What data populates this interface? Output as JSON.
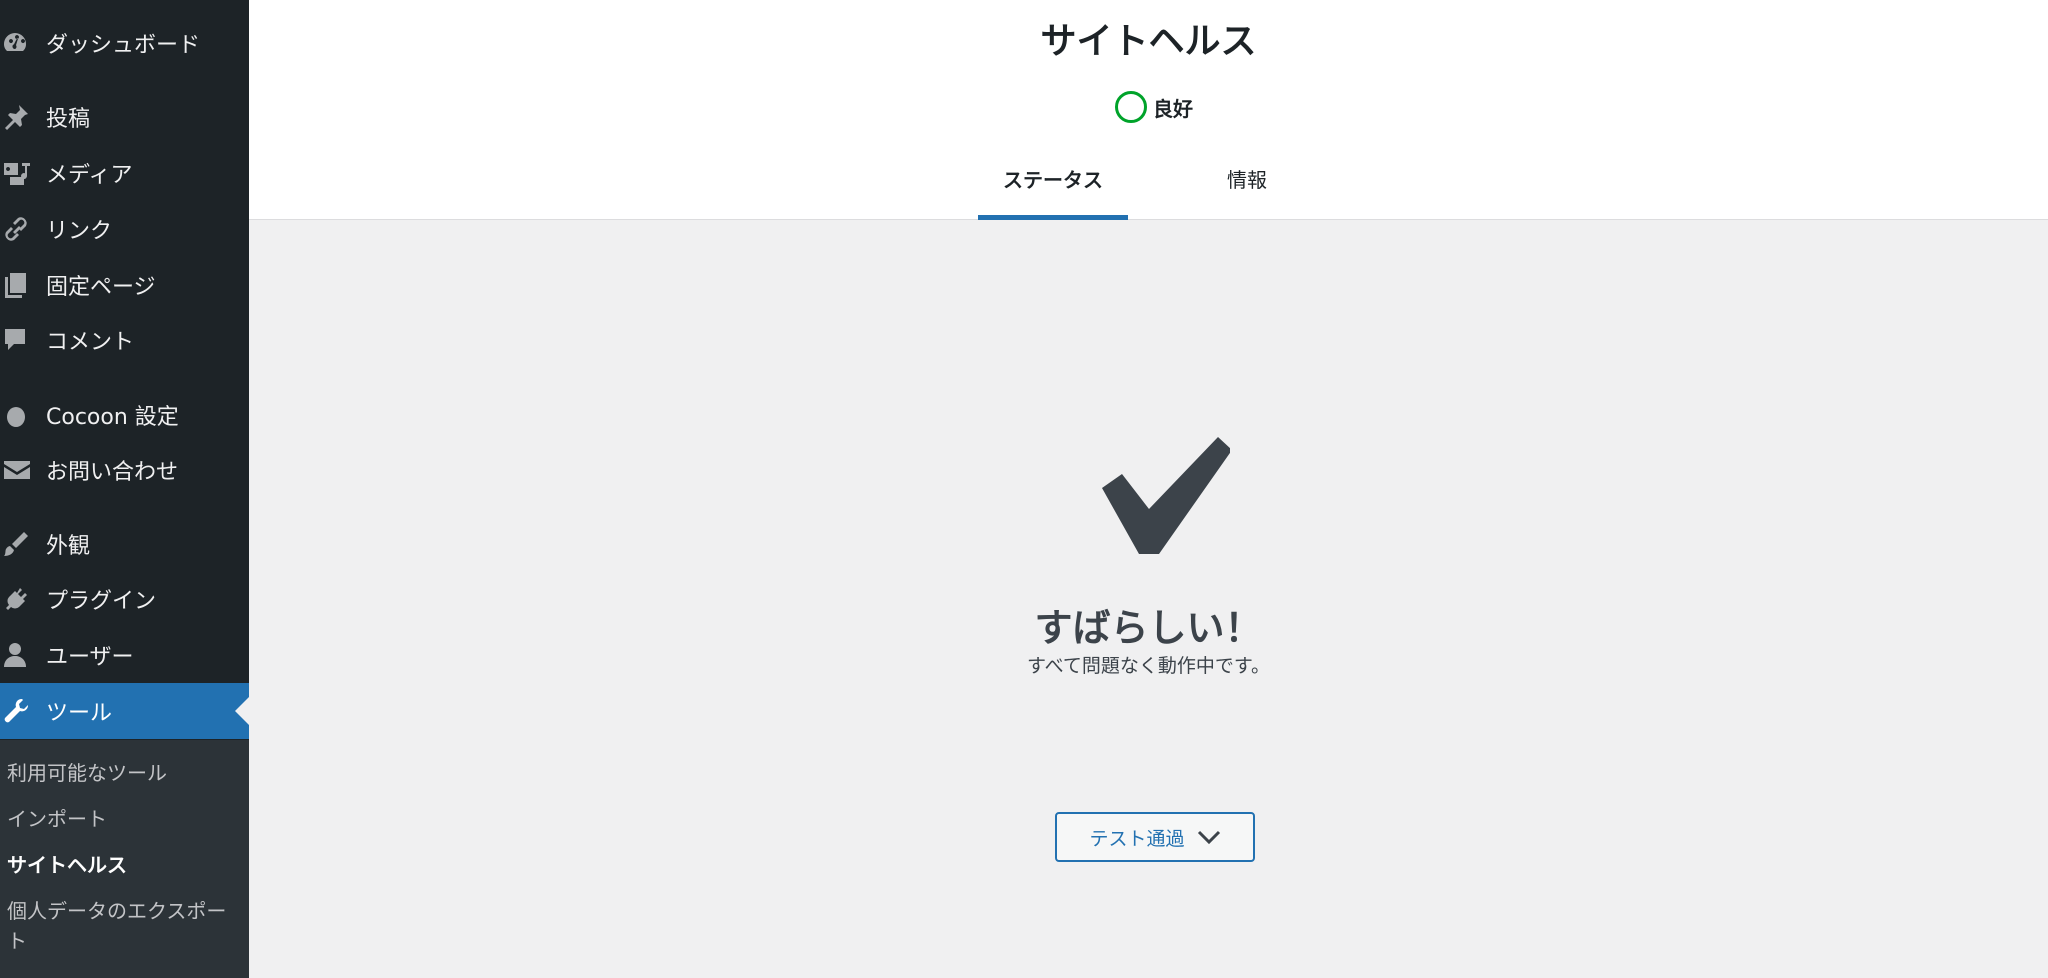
{
  "sidebar": {
    "items": [
      {
        "label": "ダッシュボード",
        "icon": "dashboard-icon"
      },
      {
        "label": "投稿",
        "icon": "pin-icon"
      },
      {
        "label": "メディア",
        "icon": "media-icon"
      },
      {
        "label": "リンク",
        "icon": "link-icon"
      },
      {
        "label": "固定ページ",
        "icon": "pages-icon"
      },
      {
        "label": "コメント",
        "icon": "comment-icon"
      },
      {
        "label": "Cocoon 設定",
        "icon": "cocoon-icon"
      },
      {
        "label": "お問い合わせ",
        "icon": "mail-icon"
      },
      {
        "label": "外観",
        "icon": "brush-icon"
      },
      {
        "label": "プラグイン",
        "icon": "plugin-icon"
      },
      {
        "label": "ユーザー",
        "icon": "user-icon"
      },
      {
        "label": "ツール",
        "icon": "wrench-icon",
        "active": true
      }
    ],
    "submenu": [
      {
        "label": "利用可能なツール"
      },
      {
        "label": "インポート"
      },
      {
        "label": "サイトヘルス",
        "current": true
      },
      {
        "label": "個人データのエクスポー"
      },
      {
        "label": "ト"
      }
    ]
  },
  "header": {
    "title": "サイトヘルス",
    "status": "良好",
    "status_color": "#00a32a",
    "tabs": [
      {
        "label": "ステータス",
        "active": true
      },
      {
        "label": "情報"
      }
    ]
  },
  "main": {
    "title": "すばらしい！",
    "subtitle": "すべて問題なく動作中です。",
    "passed_button": "テスト通過"
  },
  "colors": {
    "accent": "#2271b1",
    "sidebar_bg": "#1d2327",
    "submenu_bg": "#2c3338",
    "content_bg": "#f0f0f1"
  }
}
